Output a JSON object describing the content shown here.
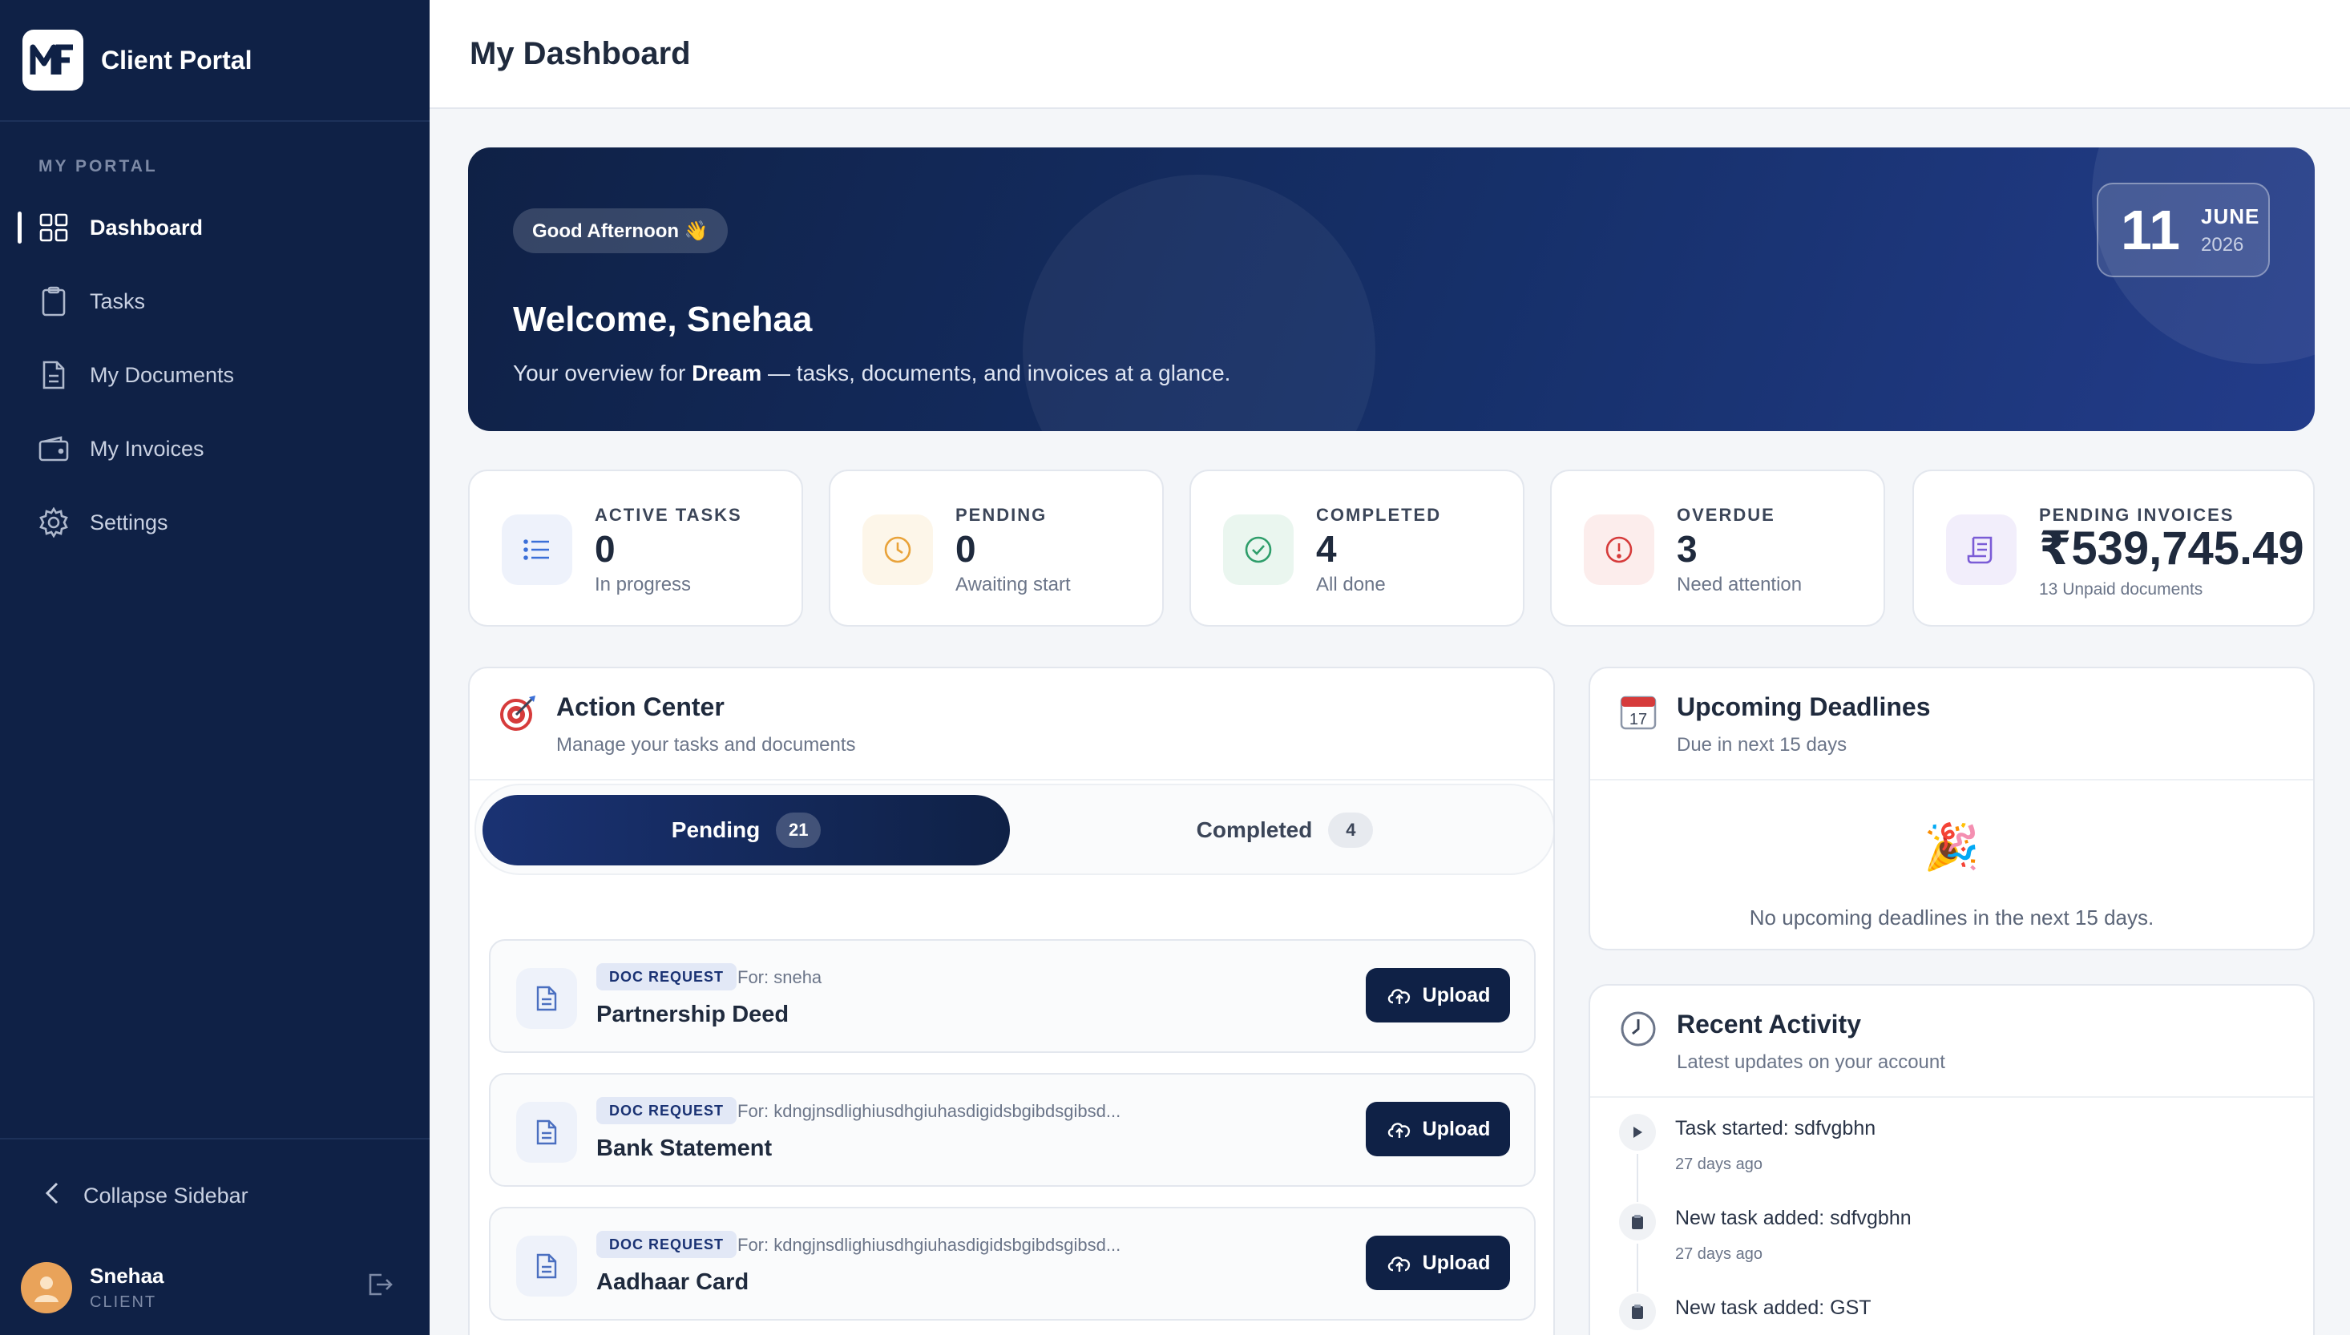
{
  "sidebar": {
    "brand": "Client Portal",
    "section_label": "MY PORTAL",
    "items": [
      {
        "label": "Dashboard",
        "icon": "grid-icon"
      },
      {
        "label": "Tasks",
        "icon": "clipboard-icon"
      },
      {
        "label": "My Documents",
        "icon": "document-icon"
      },
      {
        "label": "My Invoices",
        "icon": "wallet-icon"
      },
      {
        "label": "Settings",
        "icon": "gear-icon"
      }
    ],
    "collapse_label": "Collapse Sidebar",
    "user": {
      "name": "Snehaa",
      "role": "CLIENT"
    }
  },
  "header": {
    "title": "My Dashboard"
  },
  "hero": {
    "greeting": "Good Afternoon 👋",
    "welcome": "Welcome, Snehaa",
    "overview_prefix": "Your overview for ",
    "overview_company": "Dream",
    "overview_suffix": " — tasks, documents, and invoices at a glance.",
    "date": {
      "day": "11",
      "month": "JUNE",
      "year": "2026"
    }
  },
  "stats": [
    {
      "label": "ACTIVE TASKS",
      "value": "0",
      "sub": "In progress",
      "color": "#3b6fd8"
    },
    {
      "label": "PENDING",
      "value": "0",
      "sub": "Awaiting start",
      "color": "#e9a33a"
    },
    {
      "label": "COMPLETED",
      "value": "4",
      "sub": "All done",
      "color": "#2f9e6b"
    },
    {
      "label": "OVERDUE",
      "value": "3",
      "sub": "Need attention",
      "color": "#d63b3b"
    },
    {
      "label": "PENDING INVOICES",
      "value": "₹539,745.49",
      "sub": "13 Unpaid documents",
      "color": "#7b5cd6"
    }
  ],
  "action_center": {
    "title": "Action Center",
    "subtitle": "Manage your tasks and documents",
    "tabs": [
      {
        "label": "Pending",
        "count": "21"
      },
      {
        "label": "Completed",
        "count": "4"
      }
    ],
    "tasks": [
      {
        "badge": "DOC REQUEST",
        "for": "For: sneha",
        "name": "Partnership Deed",
        "action": "Upload"
      },
      {
        "badge": "DOC REQUEST",
        "for": "For: kdngjnsdlighiusdhgiuhasdigidsbgibdsgibsd...",
        "name": "Bank Statement",
        "action": "Upload"
      },
      {
        "badge": "DOC REQUEST",
        "for": "For: kdngjnsdlighiusdhgiuhasdigidsbgibdsgibsd...",
        "name": "Aadhaar Card",
        "action": "Upload"
      }
    ]
  },
  "deadlines": {
    "title": "Upcoming Deadlines",
    "subtitle": "Due in next 15 days",
    "empty_icon": "🎉",
    "empty_text": "No upcoming deadlines in the next 15 days."
  },
  "activity": {
    "title": "Recent Activity",
    "subtitle": "Latest updates on your account",
    "items": [
      {
        "text": "Task started: sdfvgbhn",
        "time": "27 days ago",
        "icon": "play-icon"
      },
      {
        "text": "New task added: sdfvgbhn",
        "time": "27 days ago",
        "icon": "clipboard-icon"
      },
      {
        "text": "New task added: GST",
        "time": "",
        "icon": "clipboard-icon"
      }
    ]
  }
}
